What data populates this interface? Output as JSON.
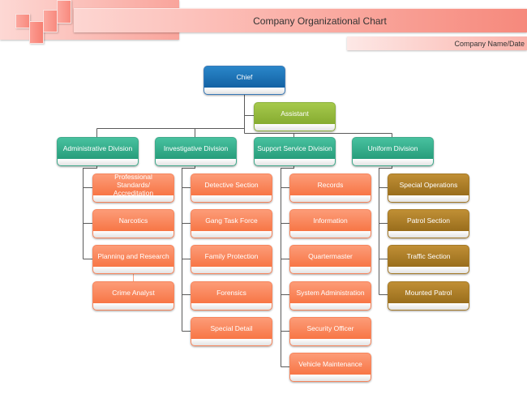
{
  "header": {
    "title": "Company Organizational Chart",
    "subtitle": "Company Name/Date"
  },
  "colors": {
    "chief": "#1a6db3",
    "assistant": "#93b83a",
    "division": "#2ea984",
    "unit_orange": "#f87e50",
    "unit_gold": "#a57a28",
    "connector": "#555555",
    "header_accent": "#f88a7e"
  },
  "chart": {
    "chief": {
      "label": "Chief"
    },
    "assistant": {
      "label": "Assistant"
    },
    "divisions": [
      {
        "label": "Administrative Division",
        "units": [
          {
            "label": "Professional Standards/ Accreditation"
          },
          {
            "label": "Narcotics"
          },
          {
            "label": "Planning and Research",
            "subunits": [
              {
                "label": "Crime Analyst"
              }
            ]
          }
        ]
      },
      {
        "label": "Investigative Division",
        "units": [
          {
            "label": "Detective Section"
          },
          {
            "label": "Gang Task Force"
          },
          {
            "label": "Family Protection"
          },
          {
            "label": "Forensics"
          },
          {
            "label": "Special Detail"
          }
        ]
      },
      {
        "label": "Support Service Division",
        "units": [
          {
            "label": "Records"
          },
          {
            "label": "Information"
          },
          {
            "label": "Quartermaster"
          },
          {
            "label": "System Administration"
          },
          {
            "label": "Security Officer"
          },
          {
            "label": "Vehicle Maintenance"
          }
        ]
      },
      {
        "label": "Uniform Division",
        "units": [
          {
            "label": "Special Operations"
          },
          {
            "label": "Patrol Section"
          },
          {
            "label": "Traffic Section"
          },
          {
            "label": "Mounted Patrol"
          }
        ]
      }
    ]
  }
}
